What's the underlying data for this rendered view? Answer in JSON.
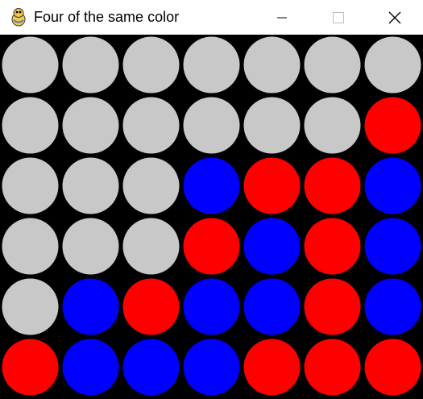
{
  "window": {
    "title": "Four of the same color",
    "app_icon": "python-snake-icon",
    "controls": [
      "minimize-icon",
      "maximize-icon",
      "close-icon"
    ]
  },
  "board": {
    "columns": 7,
    "rows": 6,
    "background_color": "#000000",
    "colors": {
      "empty": "#c8c8c8",
      "red": "#ff0000",
      "blue": "#0000ff"
    },
    "cells": [
      [
        "empty",
        "empty",
        "empty",
        "empty",
        "empty",
        "empty",
        "empty"
      ],
      [
        "empty",
        "empty",
        "empty",
        "empty",
        "empty",
        "empty",
        "red"
      ],
      [
        "empty",
        "empty",
        "empty",
        "blue",
        "red",
        "red",
        "blue"
      ],
      [
        "empty",
        "empty",
        "empty",
        "red",
        "blue",
        "red",
        "blue"
      ],
      [
        "empty",
        "blue",
        "red",
        "blue",
        "blue",
        "red",
        "blue"
      ],
      [
        "red",
        "blue",
        "blue",
        "blue",
        "red",
        "red",
        "red"
      ]
    ]
  }
}
